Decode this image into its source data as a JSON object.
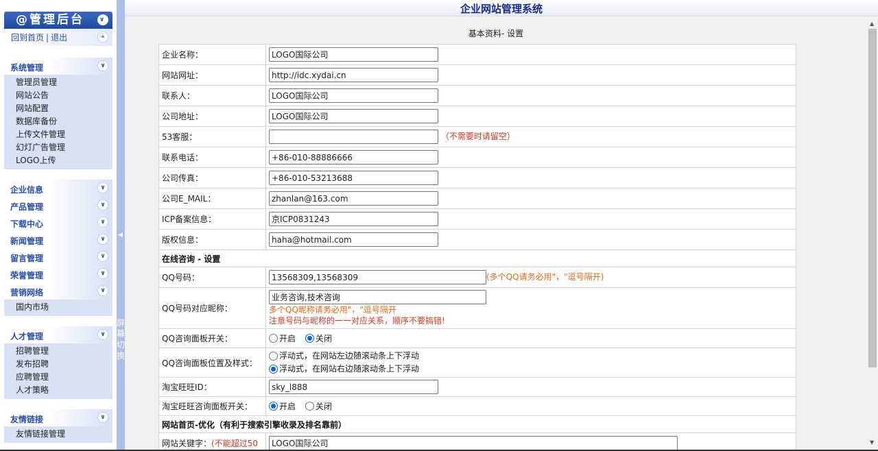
{
  "sidebar": {
    "header_title": "@管理后台",
    "home_link": "回到首页",
    "logout_link": "退出",
    "separator": "|",
    "groups": [
      {
        "title": "系统管理",
        "items": [
          "管理员管理",
          "网站公告",
          "网站配置",
          "数据库备份",
          "上传文件管理",
          "幻灯广告管理",
          "LOGO上传"
        ]
      },
      {
        "title": "企业信息",
        "items": []
      },
      {
        "title": "产品管理",
        "items": []
      },
      {
        "title": "下载中心",
        "items": []
      },
      {
        "title": "新闻管理",
        "items": []
      },
      {
        "title": "留言管理",
        "items": []
      },
      {
        "title": "荣誉管理",
        "items": []
      },
      {
        "title": "营销网络",
        "items": [
          "国内市场"
        ]
      },
      {
        "title": "人才管理",
        "items": [
          "招聘管理",
          "发布招聘",
          "应聘管理",
          "人才策略"
        ]
      },
      {
        "title": "友情链接",
        "items": [
          "友情链接管理"
        ]
      }
    ]
  },
  "splitter": {
    "text": "屏幕切换"
  },
  "main": {
    "title": "企业网站管理系统",
    "section_heading": "基本资料- 设置",
    "fields": {
      "company_name": {
        "label": "企业名称：",
        "value": "LOGO国际公司"
      },
      "website": {
        "label": "网站网址：",
        "value": "http://idc.xydai.cn"
      },
      "contact": {
        "label": "联系人：",
        "value": "LOGO国际公司"
      },
      "address": {
        "label": "公司地址：",
        "value": "LOGO国际公司"
      },
      "kefu53": {
        "label": "53客服：",
        "value": "",
        "hint": "（不需要时请留空）"
      },
      "phone": {
        "label": "联系电话：",
        "value": "+86-010-88886666"
      },
      "fax": {
        "label": "公司传真：",
        "value": "+86-010-53213688"
      },
      "email": {
        "label": "公司E_MAIL：",
        "value": "zhanlan@163.com"
      },
      "icp": {
        "label": "ICP备案信息：",
        "value": "京ICP0831243"
      },
      "copyright": {
        "label": "版权信息：",
        "value": "haha@hotmail.com"
      }
    },
    "online_section": "在线咨询 - 设置",
    "qq": {
      "label": "QQ号码：",
      "value": "13568309,13568309",
      "hint": "(多个QQ请务必用\"，\"逗号隔开)"
    },
    "qq_nick": {
      "label": "QQ号码对应昵称：",
      "value": "业务咨询,技术咨询",
      "hint1": "多个QQ昵称请务必用\"，\"逗号隔开",
      "hint2": "注意号码与昵称的一一对应关系，顺序不要搞错!"
    },
    "qq_panel_switch": {
      "label": "QQ咨询面板开关：",
      "opt_on": "开启",
      "opt_off": "关闭",
      "selected": "off"
    },
    "qq_panel_pos": {
      "label": "QQ咨询面板位置及样式：",
      "opt_left": "浮动式，在网站左边随滚动条上下浮动",
      "opt_right": "浮动式，在网站右边随滚动条上下浮动",
      "selected": "right"
    },
    "taobao_id": {
      "label": "淘宝旺旺ID：",
      "value": "sky_l888"
    },
    "taobao_switch": {
      "label": "淘宝旺旺咨询面板开关：",
      "opt_on": "开启",
      "opt_off": "关闭",
      "selected": "on"
    },
    "seo_section": "网站首页-优化（有利于搜索引擎收录及排名靠前）",
    "keywords": {
      "label": "网站关键字：",
      "hint": "(不能超过50",
      "value": "LOGO国际公司"
    }
  },
  "colors": {
    "accent": "#2a4db0",
    "title": "#1a2d8a",
    "hint_red": "#d23b2a",
    "hint_orange": "#e06a1b"
  }
}
